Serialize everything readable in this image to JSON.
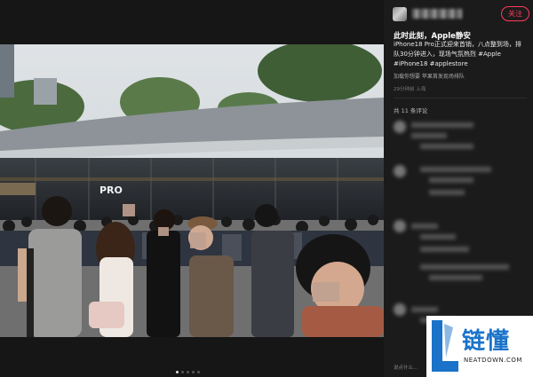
{
  "post": {
    "follow_label": "关注",
    "title": "此时此刻，Apple静安",
    "body": "iPhone18 Pro正式迎来首销，八点整到场，排队30分钟进入，现场气氛热烈",
    "hashtags": "#Apple #iPhone18 #applestore",
    "meta": "加载你想要 苹果首发现场排队",
    "published": "29分钟前 上海"
  },
  "comments": {
    "count_label": "共 11 条评论"
  },
  "footer": {
    "input_placeholder": "说点什么..."
  },
  "photo": {
    "store_sign": "PRO"
  },
  "watermark": {
    "brand": "链懂",
    "domain": "NEATDOWN.COM"
  },
  "colors": {
    "accent": "#ff3b5b",
    "logo_blue": "#1a73c9"
  }
}
